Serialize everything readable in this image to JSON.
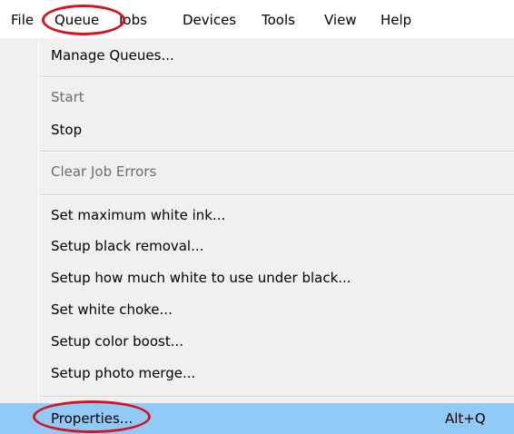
{
  "menubar": {
    "items": [
      {
        "label": "File"
      },
      {
        "label": "Queue"
      },
      {
        "label": "Jobs"
      },
      {
        "label": "Devices"
      },
      {
        "label": "Tools"
      },
      {
        "label": "View"
      },
      {
        "label": "Help"
      }
    ]
  },
  "queue_menu": {
    "items": [
      {
        "label": "Manage Queues...",
        "enabled": true
      },
      {
        "label": "Start",
        "enabled": false
      },
      {
        "label": "Stop",
        "enabled": true
      },
      {
        "label": "Clear Job Errors",
        "enabled": false
      },
      {
        "label": "Set maximum white ink...",
        "enabled": true
      },
      {
        "label": "Setup black removal...",
        "enabled": true
      },
      {
        "label": "Setup how much white to use under black...",
        "enabled": true
      },
      {
        "label": "Set white choke...",
        "enabled": true
      },
      {
        "label": "Setup color boost...",
        "enabled": true
      },
      {
        "label": "Setup photo merge...",
        "enabled": true
      },
      {
        "label": "Properties...",
        "enabled": true,
        "highlighted": true,
        "shortcut": "Alt+Q"
      }
    ]
  },
  "colors": {
    "highlight": "#91c9f7",
    "annotation": "#d6141f",
    "menu_background": "#f0f0f0",
    "disabled_text": "#6d6d6d"
  }
}
